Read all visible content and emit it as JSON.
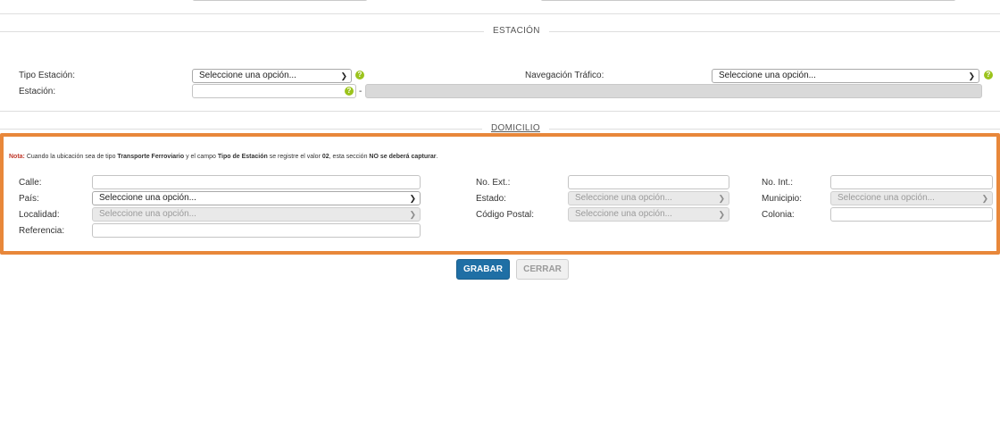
{
  "top": {},
  "estacion": {
    "title": "ESTACIÓN",
    "tipo_label": "Tipo Estación:",
    "tipo_value": "Seleccione una opción...",
    "navegacion_label": "Navegación Tráfico:",
    "navegacion_value": "Seleccione una opción...",
    "estacion_label": "Estación:",
    "separator": "-",
    "help_glyph": "?"
  },
  "domicilio": {
    "title": "DOMICILIO",
    "note": {
      "prefix": "Nota:",
      "t1": " Cuando la ubicación sea de tipo ",
      "b1": "Transporte Ferroviario",
      "t2": " y el campo ",
      "b2": "Tipo de Estación",
      "t3": " se registre el valor ",
      "b3": "02",
      "t4": ", esta sección ",
      "b4": "NO se deberá capturar",
      "t5": "."
    },
    "fields": {
      "calle_label": "Calle:",
      "no_ext_label": "No. Ext.:",
      "no_int_label": "No. Int.:",
      "pais_label": "País:",
      "pais_value": "Seleccione una opción...",
      "estado_label": "Estado:",
      "estado_value": "Seleccione una opción...",
      "municipio_label": "Municipio:",
      "municipio_value": "Seleccione una opción...",
      "localidad_label": "Localidad:",
      "localidad_value": "Seleccione una opción...",
      "cp_label": "Código Postal:",
      "cp_value": "Seleccione una opción...",
      "colonia_label": "Colonia:",
      "referencia_label": "Referencia:"
    }
  },
  "buttons": {
    "grabar": "GRABAR",
    "cerrar": "CERRAR"
  },
  "colors": {
    "highlight_border": "#e8873a",
    "note_red": "#c0392b",
    "primary_button": "#1f6fa5",
    "help_green": "#9bc31c"
  }
}
